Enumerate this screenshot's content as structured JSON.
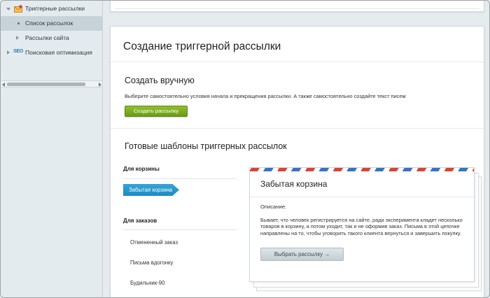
{
  "sidebar": {
    "items": [
      {
        "label": "Триггерные рассылки",
        "icon": "mail-icon"
      },
      {
        "label": "Список рассылок",
        "active": true
      },
      {
        "label": "Рассылки сайта"
      },
      {
        "label": "Поисковая оптимизация",
        "icon": "seo-icon",
        "icon_text": "SEO"
      }
    ]
  },
  "main": {
    "page_title": "Создание триггерной рассылки",
    "manual": {
      "title": "Создать вручную",
      "description": "Выберите самостоятельно условия начала и прекращения рассылки. А также самостоятельно создайте текст писем",
      "create_button": "Создать рассылку"
    },
    "templates": {
      "title": "Готовые шаблоны триггерных рассылок",
      "cart_heading": "Для корзины",
      "cart_items": [
        "Забытая корзина"
      ],
      "orders_heading": "Для заказов",
      "order_items": [
        "Отмененный заказ",
        "Письма вдогонку",
        "Будильник-90"
      ]
    },
    "card": {
      "title": "Забытая корзина",
      "label": "Описание:",
      "text": "Бывает, что человек регистрируется на сайте, ради эксперимента кладет несколько товаров в корзину, а потом уходит, так и не оформив заказ. Письма в этой цепочке направлены на то, чтобы уговорить такого клиента вернуться и завершить покупку.",
      "button": "Выбрать рассылку →"
    }
  },
  "colors": {
    "accent_green": "#7aab1f",
    "accent_blue": "#2a9bd0",
    "stripe_red": "#d9443a",
    "stripe_blue": "#3a72c4"
  }
}
